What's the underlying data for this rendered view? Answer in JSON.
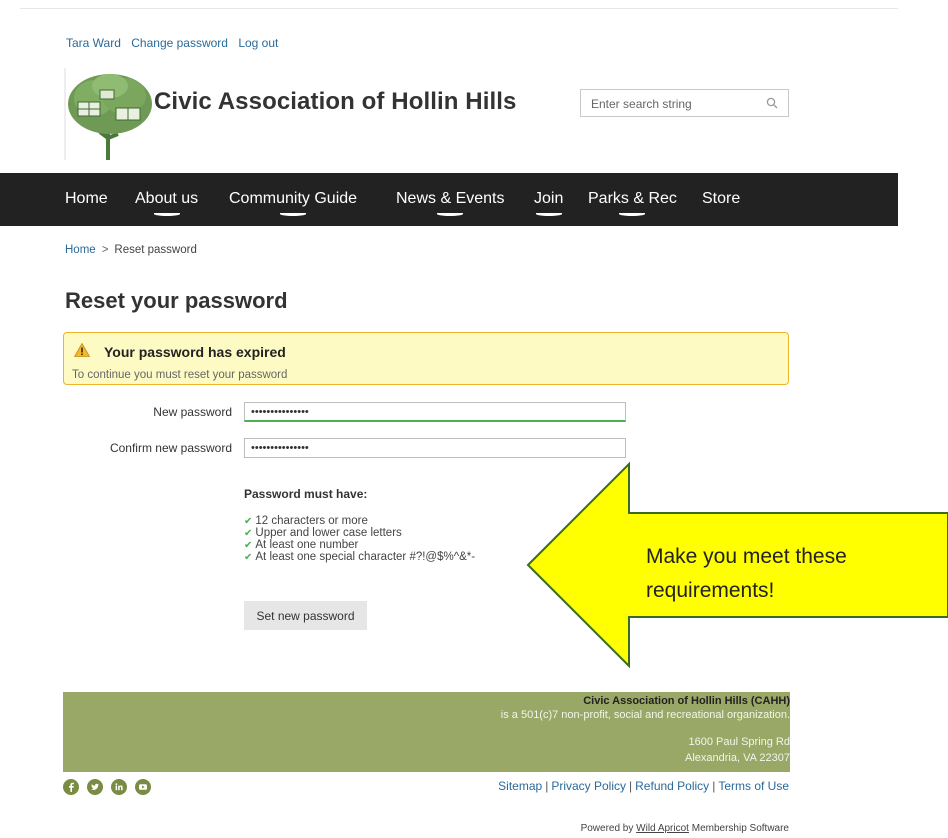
{
  "user_links": [
    "Tara Ward",
    "Change password",
    "Log out"
  ],
  "site": {
    "title": "Civic Association of Hollin Hills",
    "logo_icon": "tree-logo-icon"
  },
  "search": {
    "placeholder": "Enter search string",
    "icon": "search-icon"
  },
  "nav": [
    "Home",
    "About us",
    "Community Guide",
    "News & Events",
    "Join",
    "Parks & Rec",
    "Store"
  ],
  "breadcrumb": {
    "home": "Home",
    "separator": ">",
    "current": "Reset password"
  },
  "page_title": "Reset your password",
  "alert": {
    "title": "Your password has expired",
    "text": "To continue you must reset your password",
    "icon": "warning-icon"
  },
  "form": {
    "new_password_label": "New password",
    "new_password_value": "•••••••••••••••",
    "confirm_label": "Confirm new password",
    "confirm_value": "•••••••••••••••"
  },
  "requirements": {
    "title": "Password must have:",
    "items": [
      "12 characters or more",
      "Upper and lower case letters",
      "At least one number",
      "At least one special character #?!@$%^&*-"
    ]
  },
  "submit_label": "Set new password",
  "callout": {
    "line1": "Make you meet these",
    "line2": "requirements!",
    "color": "#ffff00",
    "border_color": "#3a6b1f"
  },
  "footer": {
    "org": "Civic Association of Hollin Hills (CAHH)",
    "description": "is a 501(c)7 non-profit, social and recreational organization.",
    "address1": "1600 Paul Spring Rd",
    "address2": "Alexandria, VA 22307",
    "background": "#99a866"
  },
  "social_icons": [
    "facebook-icon",
    "twitter-icon",
    "linkedin-icon",
    "youtube-icon"
  ],
  "footer_links": [
    "Sitemap",
    "Privacy Policy",
    "Refund Policy",
    "Terms of Use"
  ],
  "powered": {
    "prefix": "Powered by",
    "link": "Wild Apricot",
    "suffix": "Membership Software"
  },
  "colors": {
    "nav_bg": "#222222",
    "link": "#2a6a99",
    "alert_bg": "#fdfbc3",
    "alert_border": "#f0b429"
  }
}
